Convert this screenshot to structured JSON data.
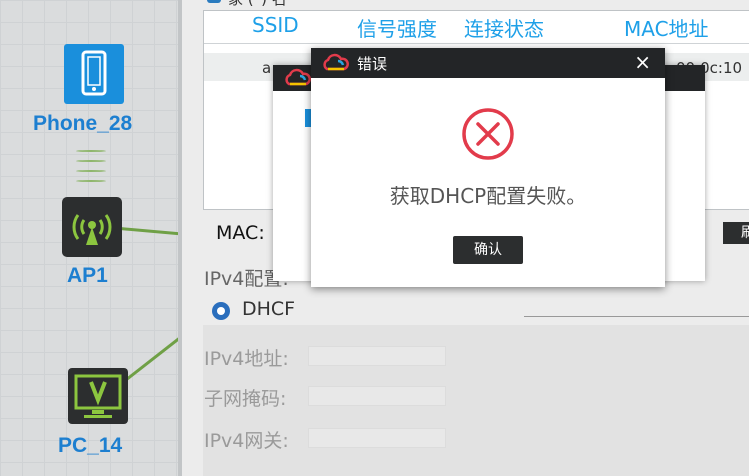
{
  "topology": {
    "devices": [
      {
        "label": "Phone_28",
        "icon": "phone-icon"
      },
      {
        "label": "AP1",
        "icon": "wireless-ap-icon"
      },
      {
        "label": "PC_14",
        "icon": "pc-icon"
      }
    ],
    "colors": {
      "label": "#1d7fd0",
      "link": "#6fa046",
      "phone": "#1a8fdc"
    }
  },
  "wlan_table": {
    "partial_header": "家   (*) 名",
    "columns": [
      "SSID",
      "信号强度",
      "连接状态",
      "MAC地址"
    ],
    "row": {
      "ssid_partial": "a",
      "mac_partial": "00:0c:10"
    }
  },
  "config": {
    "mac_label": "MAC:",
    "refresh_label": "刷",
    "ipv4_config_label": "IPv4配置:",
    "dhcp_label": "DHCF",
    "ipv4_address_label": "IPv4地址:",
    "subnet_mask_label": "子网掩码:",
    "gateway_label": "IPv4网关:"
  },
  "error_dialog": {
    "title": "错误",
    "message": "获取DHCP配置失败。",
    "ok_label": "确认",
    "close_label": "×",
    "icon": "error-circle-x-icon",
    "accent": "#e23b4b"
  }
}
